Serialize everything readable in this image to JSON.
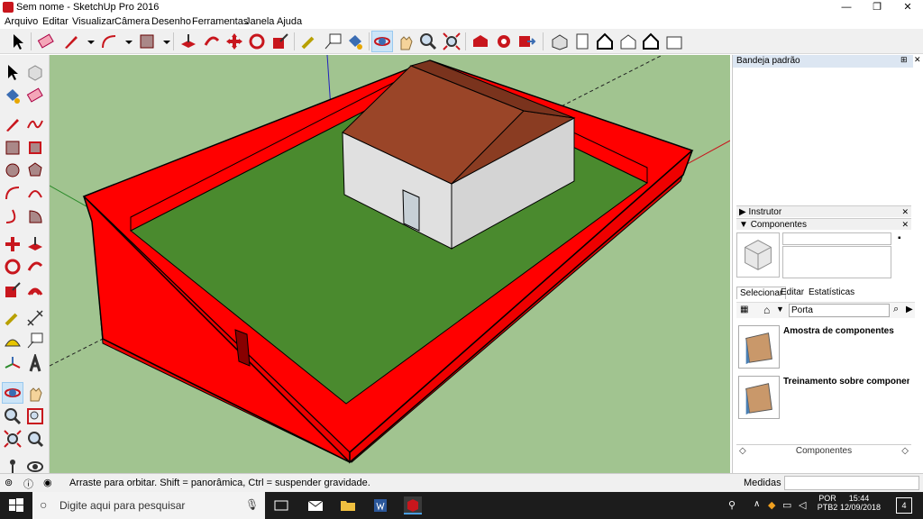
{
  "window": {
    "title": "Sem nome - SketchUp Pro 2016",
    "minimize": "—",
    "maximize": "❐",
    "close": "✕"
  },
  "menu": [
    "Arquivo",
    "Editar",
    "Visualizar",
    "Câmera",
    "Desenho",
    "Ferramentas",
    "Janela",
    "Ajuda"
  ],
  "tray": {
    "title": "Bandeja padrão",
    "pin": "⊞",
    "close": "✕",
    "panels": {
      "instructor": {
        "label": "Instrutor",
        "arrow": "▶",
        "close": "✕"
      },
      "components": {
        "label": "Componentes",
        "arrow": "▼",
        "close": "✕"
      }
    },
    "tabs": [
      "Selecionar",
      "Editar",
      "Estatísticas"
    ],
    "search_value": "Porta",
    "items": [
      {
        "title": "Amostra de componentes"
      },
      {
        "title": "Treinamento sobre component…"
      }
    ],
    "footer": "Componentes",
    "footer_left": "◇",
    "footer_right": "◇"
  },
  "status": {
    "message": "Arraste para orbitar. Shift = panorâmica, Ctrl = suspender gravidade.",
    "measure_label": "Medidas"
  },
  "taskbar": {
    "search_placeholder": "Digite aqui para pesquisar",
    "lang_top": "POR",
    "lang_bottom": "PTB2",
    "time": "15:44",
    "date": "12/09/2018",
    "notifications": "4"
  },
  "colors": {
    "wall": "#ff0000",
    "grass": "#4a8a2e",
    "roof": "#9a4528",
    "house": "#e0e0e0",
    "sky": "#a1c490"
  }
}
